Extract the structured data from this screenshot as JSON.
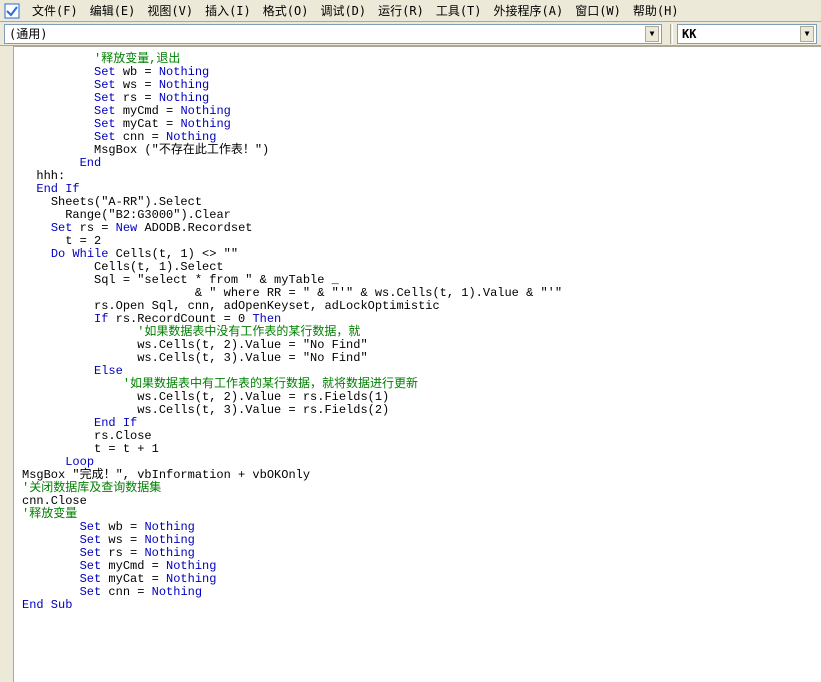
{
  "menubar": {
    "items": [
      {
        "label": "文件(F)"
      },
      {
        "label": "编辑(E)"
      },
      {
        "label": "视图(V)"
      },
      {
        "label": "插入(I)"
      },
      {
        "label": "格式(O)"
      },
      {
        "label": "调试(D)"
      },
      {
        "label": "运行(R)"
      },
      {
        "label": "工具(T)"
      },
      {
        "label": "外接程序(A)"
      },
      {
        "label": "窗口(W)"
      },
      {
        "label": "帮助(H)"
      }
    ]
  },
  "combo_left": {
    "value": "(通用)"
  },
  "combo_right": {
    "value": "KK"
  },
  "code_lines": [
    {
      "i": 10,
      "spans": [
        {
          "c": "cm",
          "t": "'释放变量,退出"
        }
      ]
    },
    {
      "i": 10,
      "spans": [
        {
          "c": "kw",
          "t": "Set"
        },
        {
          "t": " wb = "
        },
        {
          "c": "kw",
          "t": "Nothing"
        }
      ]
    },
    {
      "i": 10,
      "spans": [
        {
          "c": "kw",
          "t": "Set"
        },
        {
          "t": " ws = "
        },
        {
          "c": "kw",
          "t": "Nothing"
        }
      ]
    },
    {
      "i": 10,
      "spans": [
        {
          "c": "kw",
          "t": "Set"
        },
        {
          "t": " rs = "
        },
        {
          "c": "kw",
          "t": "Nothing"
        }
      ]
    },
    {
      "i": 10,
      "spans": [
        {
          "c": "kw",
          "t": "Set"
        },
        {
          "t": " myCmd = "
        },
        {
          "c": "kw",
          "t": "Nothing"
        }
      ]
    },
    {
      "i": 10,
      "spans": [
        {
          "c": "kw",
          "t": "Set"
        },
        {
          "t": " myCat = "
        },
        {
          "c": "kw",
          "t": "Nothing"
        }
      ]
    },
    {
      "i": 10,
      "spans": [
        {
          "c": "kw",
          "t": "Set"
        },
        {
          "t": " cnn = "
        },
        {
          "c": "kw",
          "t": "Nothing"
        }
      ]
    },
    {
      "i": 10,
      "spans": [
        {
          "t": "MsgBox (\"不存在此工作表！\")"
        }
      ]
    },
    {
      "i": 8,
      "spans": [
        {
          "c": "kw",
          "t": "End"
        }
      ]
    },
    {
      "i": 2,
      "spans": [
        {
          "t": "hhh:"
        }
      ]
    },
    {
      "i": 2,
      "spans": [
        {
          "c": "kw",
          "t": "End If"
        }
      ]
    },
    {
      "i": 4,
      "spans": [
        {
          "t": "Sheets(\"A-RR\").Select"
        }
      ]
    },
    {
      "i": 6,
      "spans": [
        {
          "t": "Range(\"B2:G3000\").Clear"
        }
      ]
    },
    {
      "i": 4,
      "spans": [
        {
          "c": "kw",
          "t": "Set"
        },
        {
          "t": " rs = "
        },
        {
          "c": "kw",
          "t": "New"
        },
        {
          "t": " ADODB.Recordset"
        }
      ]
    },
    {
      "i": 6,
      "spans": [
        {
          "t": "t = 2"
        }
      ]
    },
    {
      "i": 4,
      "spans": [
        {
          "c": "kw",
          "t": "Do While"
        },
        {
          "t": " Cells(t, 1) <> \"\""
        }
      ]
    },
    {
      "i": 10,
      "spans": [
        {
          "t": "Cells(t, 1).Select"
        }
      ]
    },
    {
      "i": 10,
      "spans": [
        {
          "t": "Sql = \"select * from \" & myTable _"
        }
      ]
    },
    {
      "i": 24,
      "spans": [
        {
          "t": "& \" where RR = \" & \"'\" & ws.Cells(t, 1).Value & \"'\""
        }
      ]
    },
    {
      "i": 10,
      "spans": [
        {
          "t": "rs.Open Sql, cnn, adOpenKeyset, adLockOptimistic"
        }
      ]
    },
    {
      "i": 10,
      "spans": [
        {
          "c": "kw",
          "t": "If"
        },
        {
          "t": " rs.RecordCount = 0 "
        },
        {
          "c": "kw",
          "t": "Then"
        }
      ]
    },
    {
      "i": 16,
      "spans": [
        {
          "c": "cm",
          "t": "'如果数据表中没有工作表的某行数据，就"
        }
      ]
    },
    {
      "i": 16,
      "spans": [
        {
          "t": "ws.Cells(t, 2).Value = \"No Find\""
        }
      ]
    },
    {
      "i": 16,
      "spans": [
        {
          "t": "ws.Cells(t, 3).Value = \"No Find\""
        }
      ]
    },
    {
      "i": 0,
      "spans": [
        {
          "t": ""
        }
      ]
    },
    {
      "i": 10,
      "spans": [
        {
          "c": "kw",
          "t": "Else"
        }
      ]
    },
    {
      "i": 14,
      "spans": [
        {
          "c": "cm",
          "t": "'如果数据表中有工作表的某行数据，就将数据进行更新"
        }
      ]
    },
    {
      "i": 16,
      "spans": [
        {
          "t": "ws.Cells(t, 2).Value = rs.Fields(1)"
        }
      ]
    },
    {
      "i": 16,
      "spans": [
        {
          "t": "ws.Cells(t, 3).Value = rs.Fields(2)"
        }
      ]
    },
    {
      "i": 0,
      "spans": [
        {
          "t": ""
        }
      ]
    },
    {
      "i": 10,
      "spans": [
        {
          "c": "kw",
          "t": "End If"
        }
      ]
    },
    {
      "i": 10,
      "spans": [
        {
          "t": "rs.Close"
        }
      ]
    },
    {
      "i": 10,
      "spans": [
        {
          "t": "t = t + 1"
        }
      ]
    },
    {
      "i": 0,
      "spans": [
        {
          "t": ""
        }
      ]
    },
    {
      "i": 6,
      "spans": [
        {
          "c": "kw",
          "t": "Loop"
        }
      ]
    },
    {
      "i": 0,
      "spans": [
        {
          "t": "MsgBox \"完成！\", vbInformation + vbOKOnly"
        }
      ]
    },
    {
      "i": 0,
      "spans": [
        {
          "t": ""
        }
      ]
    },
    {
      "i": 0,
      "spans": [
        {
          "c": "cm",
          "t": "'关闭数据库及查询数据集"
        }
      ]
    },
    {
      "i": 0,
      "spans": [
        {
          "t": "cnn.Close"
        }
      ]
    },
    {
      "i": 0,
      "spans": [
        {
          "c": "cm",
          "t": "'释放变量"
        }
      ]
    },
    {
      "i": 8,
      "spans": [
        {
          "c": "kw",
          "t": "Set"
        },
        {
          "t": " wb = "
        },
        {
          "c": "kw",
          "t": "Nothing"
        }
      ]
    },
    {
      "i": 8,
      "spans": [
        {
          "c": "kw",
          "t": "Set"
        },
        {
          "t": " ws = "
        },
        {
          "c": "kw",
          "t": "Nothing"
        }
      ]
    },
    {
      "i": 8,
      "spans": [
        {
          "c": "kw",
          "t": "Set"
        },
        {
          "t": " rs = "
        },
        {
          "c": "kw",
          "t": "Nothing"
        }
      ]
    },
    {
      "i": 8,
      "spans": [
        {
          "c": "kw",
          "t": "Set"
        },
        {
          "t": " myCmd = "
        },
        {
          "c": "kw",
          "t": "Nothing"
        }
      ]
    },
    {
      "i": 8,
      "spans": [
        {
          "c": "kw",
          "t": "Set"
        },
        {
          "t": " myCat = "
        },
        {
          "c": "kw",
          "t": "Nothing"
        }
      ]
    },
    {
      "i": 8,
      "spans": [
        {
          "c": "kw",
          "t": "Set"
        },
        {
          "t": " cnn = "
        },
        {
          "c": "kw",
          "t": "Nothing"
        }
      ]
    },
    {
      "i": 0,
      "spans": [
        {
          "c": "kw",
          "t": "End Sub"
        }
      ]
    }
  ]
}
